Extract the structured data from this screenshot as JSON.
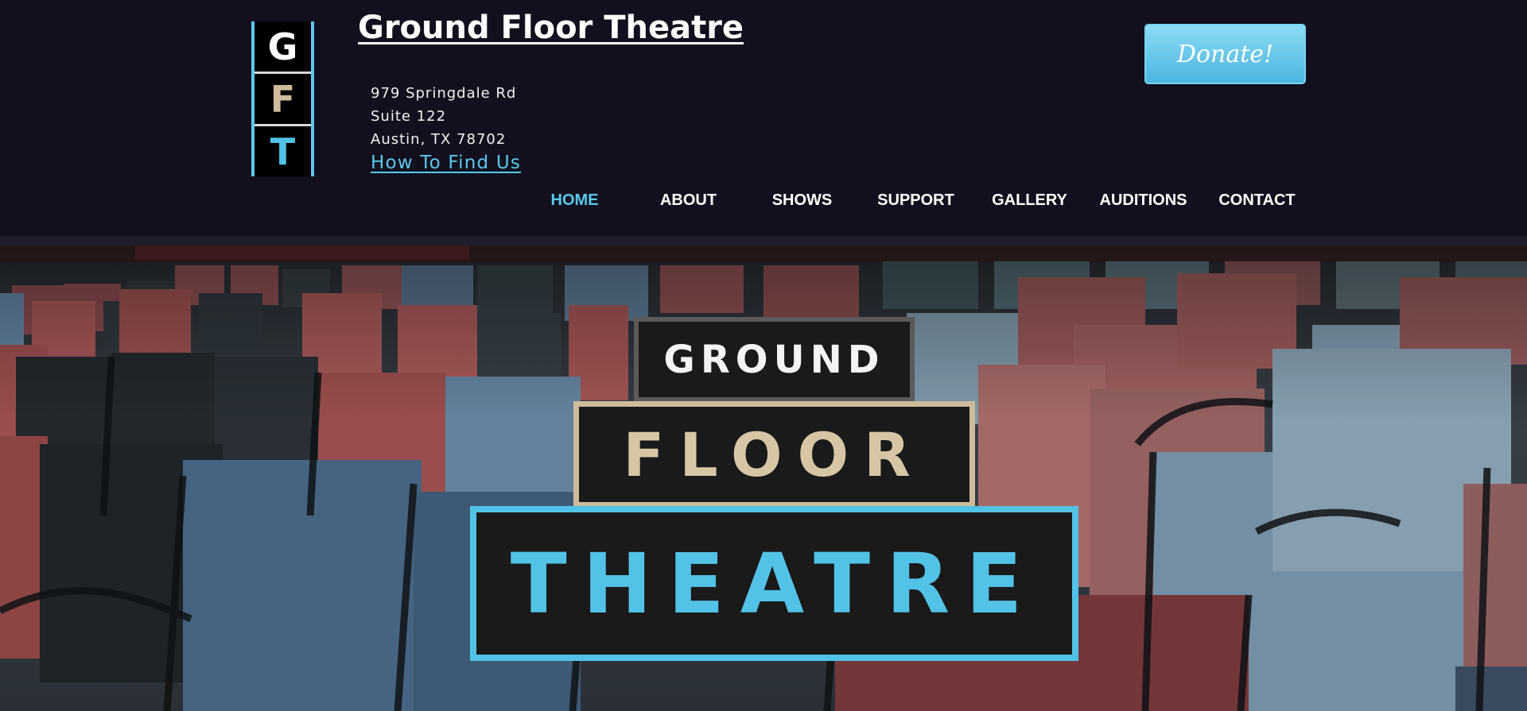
{
  "header": {
    "logo_letters": [
      "G",
      "F",
      "T"
    ],
    "logo_letter_colors": [
      "#ffffff",
      "#cdbb9c",
      "#52c2e6"
    ],
    "site_title": "Ground Floor Theatre",
    "address": {
      "line1": "979 Springdale Rd",
      "line2": "Suite 122",
      "line3": "Austin, TX  78702"
    },
    "find_link": "How To Find Us",
    "donate_label": "Donate!"
  },
  "nav": {
    "items": [
      {
        "label": "HOME",
        "active": true
      },
      {
        "label": "ABOUT",
        "active": false
      },
      {
        "label": "SHOWS",
        "active": false
      },
      {
        "label": "SUPPORT",
        "active": false
      },
      {
        "label": "GALLERY",
        "active": false
      },
      {
        "label": "AUDITIONS",
        "active": false
      },
      {
        "label": "CONTACT",
        "active": false
      }
    ]
  },
  "hero": {
    "logo_line1": "GROUND",
    "logo_line2": "FLOOR",
    "logo_line3": "THEATRE"
  },
  "colors": {
    "header_bg": "#12101e",
    "accent_blue": "#5bc8ea",
    "tan": "#cdbb9c"
  }
}
